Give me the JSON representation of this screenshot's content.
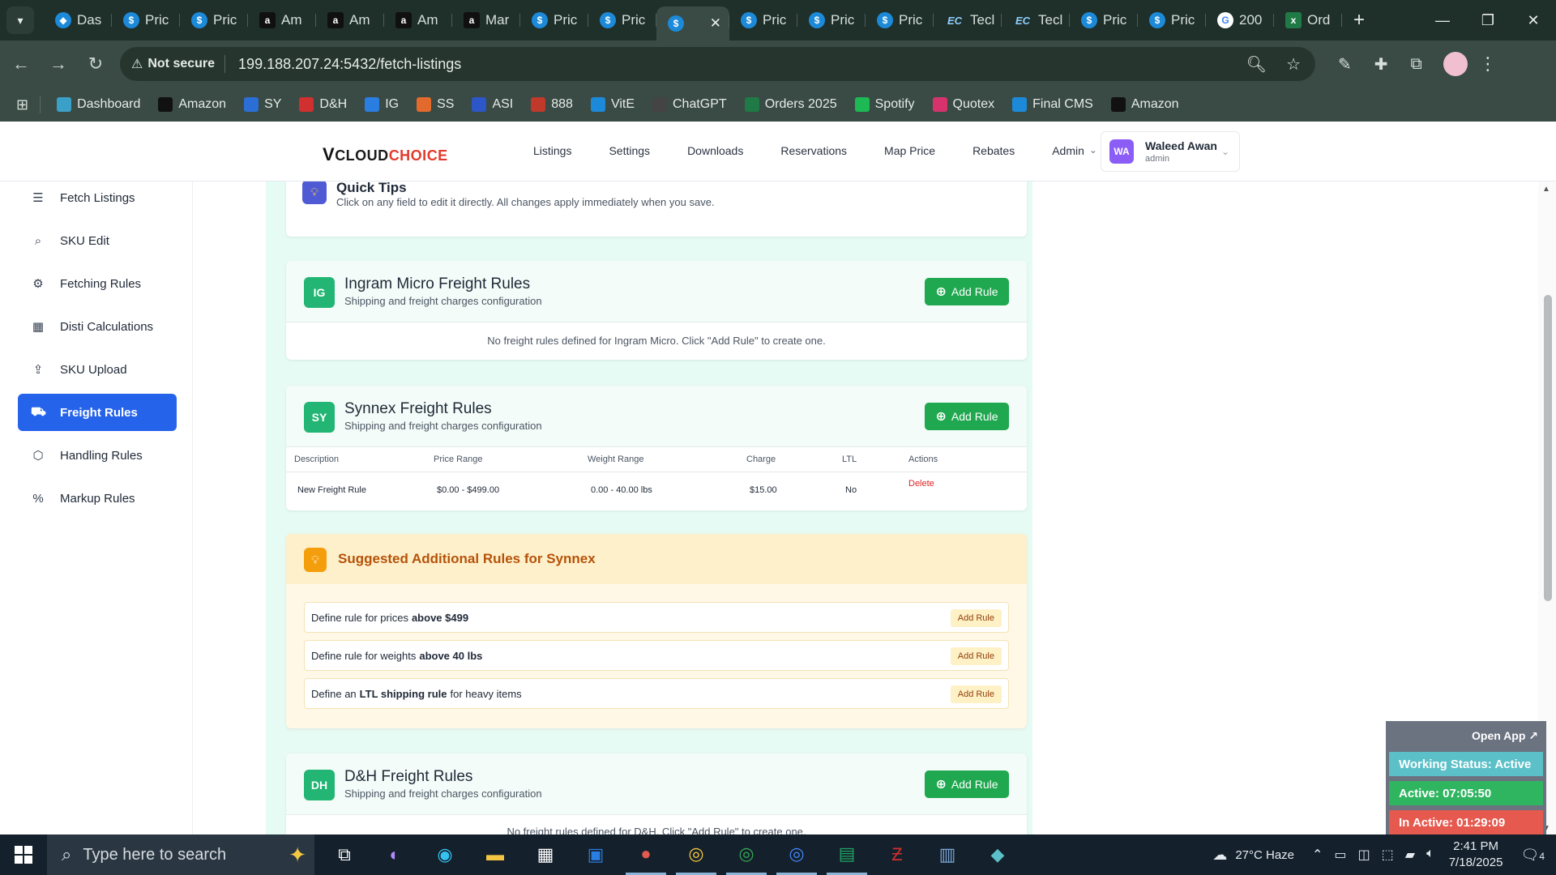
{
  "browser": {
    "tabs": [
      {
        "label": "Das",
        "icon": "dashboard-icon"
      },
      {
        "label": "Pric",
        "icon": "dollar-icon"
      },
      {
        "label": "Pric",
        "icon": "dollar-icon"
      },
      {
        "label": "Am",
        "icon": "amazon-icon"
      },
      {
        "label": "Am",
        "icon": "amazon-icon"
      },
      {
        "label": "Am",
        "icon": "amazon-icon"
      },
      {
        "label": "Mar",
        "icon": "amazon-icon"
      },
      {
        "label": "Pric",
        "icon": "dollar-icon"
      },
      {
        "label": "Pric",
        "icon": "dollar-icon"
      },
      {
        "label": "",
        "icon": "dollar-icon",
        "active": true
      },
      {
        "label": "Pric",
        "icon": "dollar-icon"
      },
      {
        "label": "Pric",
        "icon": "dollar-icon"
      },
      {
        "label": "Pric",
        "icon": "dollar-icon"
      },
      {
        "label": "Tecl",
        "icon": "ec-icon"
      },
      {
        "label": "Tecl",
        "icon": "ec-icon"
      },
      {
        "label": "Pric",
        "icon": "dollar-icon"
      },
      {
        "label": "Pric",
        "icon": "dollar-icon"
      },
      {
        "label": "200",
        "icon": "google-icon"
      },
      {
        "label": "Ord",
        "icon": "excel-icon"
      }
    ],
    "security_label": "Not secure",
    "url": "199.188.207.24:5432/fetch-listings",
    "bookmarks": [
      {
        "label": "Dashboard",
        "color": "#3aa0c8"
      },
      {
        "label": "Amazon",
        "color": "#111111"
      },
      {
        "label": "SY",
        "color": "#2b6fd6"
      },
      {
        "label": "D&H",
        "color": "#d0302f"
      },
      {
        "label": "IG",
        "color": "#2a7de1"
      },
      {
        "label": "SS",
        "color": "#e26a2c"
      },
      {
        "label": "ASI",
        "color": "#2d56c9"
      },
      {
        "label": "888",
        "color": "#c0392b"
      },
      {
        "label": "VitE",
        "color": "#1c8ad9"
      },
      {
        "label": "ChatGPT",
        "color": "#444444"
      },
      {
        "label": "Orders 2025",
        "color": "#1f7a45"
      },
      {
        "label": "Spotify",
        "color": "#1db954"
      },
      {
        "label": "Quotex",
        "color": "#d6336c"
      },
      {
        "label": "Final CMS",
        "color": "#1c8ad9"
      },
      {
        "label": "Amazon",
        "color": "#111111"
      }
    ]
  },
  "app": {
    "logo": {
      "v": "V",
      "cloud": "CLOUD",
      "choice": "CHOICE"
    },
    "nav": [
      "Listings",
      "Settings",
      "Downloads",
      "Reservations",
      "Map Price",
      "Rebates",
      "Admin"
    ],
    "user": {
      "initials": "WA",
      "name": "Waleed Awan",
      "role": "admin"
    }
  },
  "sidebar": {
    "items": [
      {
        "label": "Fetch Listings",
        "icon": "list-icon"
      },
      {
        "label": "SKU Edit",
        "icon": "search-icon"
      },
      {
        "label": "Fetching Rules",
        "icon": "gear-icon"
      },
      {
        "label": "Disti Calculations",
        "icon": "calculator-icon"
      },
      {
        "label": "SKU Upload",
        "icon": "upload-icon"
      },
      {
        "label": "Freight Rules",
        "icon": "truck-icon",
        "active": true
      },
      {
        "label": "Handling Rules",
        "icon": "box-icon"
      },
      {
        "label": "Markup Rules",
        "icon": "percent-icon"
      }
    ]
  },
  "tips": {
    "title": "Quick Tips",
    "text": "Click on any field to edit it directly. All changes apply immediately when you save."
  },
  "ingram": {
    "badge": "IG",
    "title": "Ingram Micro Freight Rules",
    "subtitle": "Shipping and freight charges configuration",
    "add": "Add Rule",
    "empty": "No freight rules defined for Ingram Micro. Click \"Add Rule\" to create one."
  },
  "synnex": {
    "badge": "SY",
    "title": "Synnex Freight Rules",
    "subtitle": "Shipping and freight charges configuration",
    "add": "Add Rule",
    "columns": [
      "Description",
      "Price Range",
      "Weight Range",
      "Charge",
      "LTL",
      "Actions"
    ],
    "rows": [
      {
        "description": "New Freight Rule",
        "price": "$0.00 - $499.00",
        "weight": "0.00 - 40.00 lbs",
        "charge": "$15.00",
        "ltl": "No",
        "action": "Delete"
      }
    ]
  },
  "suggest": {
    "title": "Suggested Additional Rules for Synnex",
    "rows": [
      {
        "pre": "Define rule for prices",
        "bold": "above $499",
        "post": "",
        "btn": "Add Rule"
      },
      {
        "pre": "Define rule for weights",
        "bold": "above 40 lbs",
        "post": "",
        "btn": "Add Rule"
      },
      {
        "pre": "Define an",
        "bold": "LTL shipping rule",
        "post": "for heavy items",
        "btn": "Add Rule"
      }
    ]
  },
  "dh": {
    "badge": "DH",
    "title": "D&H Freight Rules",
    "subtitle": "Shipping and freight charges configuration",
    "add": "Add Rule",
    "empty": "No freight rules defined for D&H. Click \"Add Rule\" to create one."
  },
  "widget": {
    "open": "Open App ↗",
    "status": "Working Status: Active",
    "active": "Active: 07:05:50",
    "inactive": "In Active: 01:29:09",
    "colors": {
      "status": "#5bc0c8",
      "active": "#2fb560",
      "inactive": "#e5594f"
    }
  },
  "taskbar": {
    "search_placeholder": "Type here to search",
    "weather": "27°C  Haze",
    "time": "2:41 PM",
    "date": "7/18/2025",
    "notifications": "4"
  }
}
